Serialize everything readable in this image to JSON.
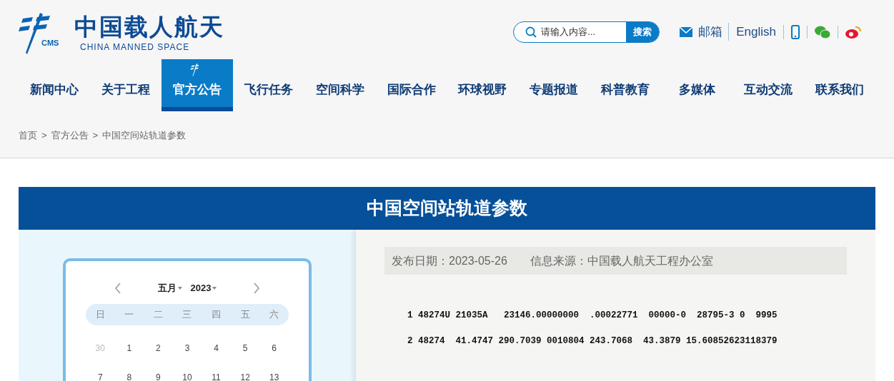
{
  "logo": {
    "title": "中国载人航天",
    "subtitle": "CHINA MANNED SPACE",
    "mark": "CMS"
  },
  "search": {
    "placeholder": "请输入内容...",
    "button": "搜索"
  },
  "top_links": [
    {
      "kind": "mail",
      "label": "邮箱"
    },
    {
      "kind": "text",
      "label": "English"
    },
    {
      "kind": "phone"
    },
    {
      "kind": "wechat"
    },
    {
      "kind": "weibo"
    }
  ],
  "nav": [
    {
      "label": "新闻中心",
      "selected": false
    },
    {
      "label": "关于工程",
      "selected": false
    },
    {
      "label": "官方公告",
      "selected": true
    },
    {
      "label": "飞行任务",
      "selected": false
    },
    {
      "label": "空间科学",
      "selected": false
    },
    {
      "label": "国际合作",
      "selected": false
    },
    {
      "label": "环球视野",
      "selected": false
    },
    {
      "label": "专题报道",
      "selected": false
    },
    {
      "label": "科普教育",
      "selected": false
    },
    {
      "label": "多媒体",
      "selected": false
    },
    {
      "label": "互动交流",
      "selected": false
    },
    {
      "label": "联系我们",
      "selected": false
    }
  ],
  "breadcrumb": [
    "首页",
    ">",
    "官方公告",
    ">",
    "中国空间站轨道参数"
  ],
  "article": {
    "title": "中国空间站轨道参数",
    "date": "发布日期：2023-05-26",
    "source": "信息来源：中国载人航天工程办公室",
    "lines": [
      "1 48274U 21035A   23146.00000000  .00022771  00000-0  28795-3 0  9995",
      "2 48274  41.4747 290.7039 0010804 243.7068  43.3879 15.60852623118379"
    ]
  },
  "calendar": {
    "month": "五月",
    "year": "2023",
    "weekdays": [
      "日",
      "一",
      "二",
      "三",
      "四",
      "五",
      "六"
    ],
    "weeks": [
      [
        {
          "day": "30",
          "muted": true
        },
        {
          "day": "1",
          "muted": false
        },
        {
          "day": "2",
          "muted": false
        },
        {
          "day": "3",
          "muted": false
        },
        {
          "day": "4",
          "muted": false
        },
        {
          "day": "5",
          "muted": false
        },
        {
          "day": "6",
          "muted": false
        }
      ],
      [
        {
          "day": "7",
          "muted": false
        },
        {
          "day": "8",
          "muted": false
        },
        {
          "day": "9",
          "muted": false
        },
        {
          "day": "10",
          "muted": false
        },
        {
          "day": "11",
          "muted": false
        },
        {
          "day": "12",
          "muted": false
        },
        {
          "day": "13",
          "muted": false
        }
      ]
    ]
  }
}
